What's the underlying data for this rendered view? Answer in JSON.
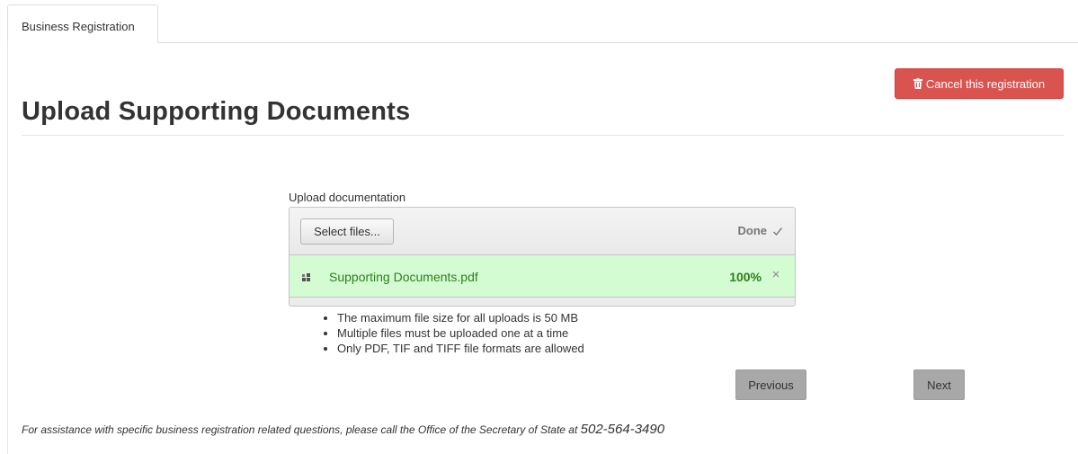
{
  "tabs": [
    {
      "label": "Business Registration"
    }
  ],
  "header": {
    "cancel_label": "Cancel this registration",
    "cancel_icon": "trash-icon",
    "title": "Upload Supporting Documents"
  },
  "upload": {
    "label": "Upload documentation",
    "select_label": "Select files...",
    "status": "Done",
    "status_icon": "check-icon",
    "file": {
      "name": "Supporting Documents.pdf",
      "progress": "100%",
      "icon": "file-icon",
      "remove_icon": "close-icon"
    }
  },
  "notes": [
    "The maximum file size for all uploads is 50 MB",
    "Multiple files must be uploaded one at a time",
    "Only PDF, TIF and TIFF file formats are allowed"
  ],
  "nav": {
    "previous_label": "Previous",
    "next_label": "Next"
  },
  "footer": {
    "assist_text": "For assistance with specific business registration related questions, please call the Office of the Secretary of State at ",
    "phone": "502-564-3490"
  },
  "colors": {
    "danger": "#d9534f",
    "success_bg": "#d4fcd2",
    "success_text": "#2f7d1f",
    "disabled_btn": "#a8a8a8"
  }
}
